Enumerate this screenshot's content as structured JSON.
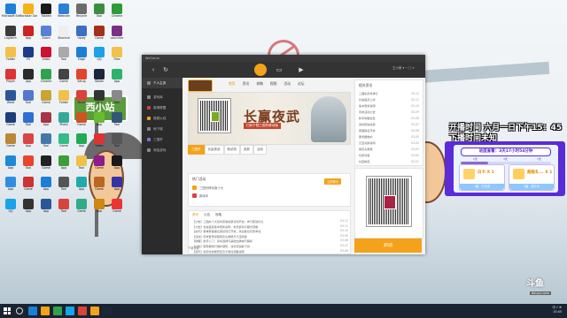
{
  "desktop": {
    "icons": [
      {
        "label": "Microsoft Edge",
        "color": "#1d7fd8"
      },
      {
        "label": "Rockstar Games",
        "color": "#f6b21b"
      },
      {
        "label": "Tabbed",
        "color": "#1a1a1a"
      },
      {
        "label": "Webcam",
        "color": "#2b7fd8"
      },
      {
        "label": "Recycle",
        "color": "#6c6c6c"
      },
      {
        "label": "Tool",
        "color": "#3a8f3e"
      },
      {
        "label": "Chrome",
        "color": "#2d9b3a"
      },
      {
        "label": "Logitech",
        "color": "#3b3b3b"
      },
      {
        "label": "App",
        "color": "#c22"
      },
      {
        "label": "Zoom",
        "color": "#5a7fd6"
      },
      {
        "label": "Shortcut",
        "color": "#eee"
      },
      {
        "label": "Uplay",
        "color": "#3a6ec4"
      },
      {
        "label": "Game",
        "color": "#a3301c"
      },
      {
        "label": "Launcher",
        "color": "#7a2f87"
      },
      {
        "label": "Folder",
        "color": "#f0c24a"
      },
      {
        "label": "PS",
        "color": "#1f3a8a"
      },
      {
        "label": "Video",
        "color": "#c13"
      },
      {
        "label": "Tool",
        "color": "#aaa"
      },
      {
        "label": "Edge",
        "color": "#1b7fd6"
      },
      {
        "label": "QQ",
        "color": "#1aa3e8"
      },
      {
        "label": "Files",
        "color": "#f0c24a"
      },
      {
        "label": "Player",
        "color": "#d33"
      },
      {
        "label": "App",
        "color": "#2a2a2a"
      },
      {
        "label": "Chrome",
        "color": "#31a24c"
      },
      {
        "label": "Game",
        "color": "#444"
      },
      {
        "label": "Setup",
        "color": "#e2452a"
      },
      {
        "label": "Steam",
        "color": "#1b2838"
      },
      {
        "label": "App",
        "color": "#2cb36b"
      },
      {
        "label": "Word",
        "color": "#2b5797"
      },
      {
        "label": "Tool",
        "color": "#5577cc"
      },
      {
        "label": "Game",
        "color": "#c8a434"
      },
      {
        "label": "Folder",
        "color": "#f0c24a"
      },
      {
        "label": "Music",
        "color": "#d9433b"
      },
      {
        "label": "App",
        "color": "#333"
      },
      {
        "label": "Tool",
        "color": "#888"
      },
      {
        "label": "Game",
        "color": "#1b3f7a"
      },
      {
        "label": "Tool",
        "color": "#2f6fd1"
      },
      {
        "label": "App",
        "color": "#a34"
      },
      {
        "label": "Photo",
        "color": "#3a9"
      },
      {
        "label": "Game",
        "color": "#c52"
      },
      {
        "label": "App",
        "color": "#6b3"
      },
      {
        "label": "Tool",
        "color": "#357"
      },
      {
        "label": "Game",
        "color": "#b83"
      },
      {
        "label": "App",
        "color": "#d44"
      },
      {
        "label": "Tool",
        "color": "#47a"
      },
      {
        "label": "Game",
        "color": "#3b8"
      },
      {
        "label": "App",
        "color": "#2a5"
      },
      {
        "label": "Video",
        "color": "#d33"
      },
      {
        "label": "Tool",
        "color": "#555"
      },
      {
        "label": "App",
        "color": "#1c8ad6"
      },
      {
        "label": "Tool",
        "color": "#e8442f"
      },
      {
        "label": "Game",
        "color": "#222"
      },
      {
        "label": "App",
        "color": "#3c9d3a"
      },
      {
        "label": "Tool",
        "color": "#f0c24a"
      },
      {
        "label": "Game",
        "color": "#8d1d8a"
      },
      {
        "label": "App",
        "color": "#1a1a1a"
      },
      {
        "label": "App",
        "color": "#2f8ee0"
      },
      {
        "label": "Game",
        "color": "#c33"
      },
      {
        "label": "App",
        "color": "#1b7fd6"
      },
      {
        "label": "Tool",
        "color": "#555"
      },
      {
        "label": "App",
        "color": "#2aa"
      },
      {
        "label": "Game",
        "color": "#b62"
      },
      {
        "label": "App",
        "color": "#33a"
      },
      {
        "label": "QQ",
        "color": "#1aa3e8"
      },
      {
        "label": "App",
        "color": "#333"
      },
      {
        "label": "App",
        "color": "#2b5797"
      },
      {
        "label": "Tool",
        "color": "#d9433b"
      },
      {
        "label": "Game",
        "color": "#3a8"
      },
      {
        "label": "App",
        "color": "#c81"
      },
      {
        "label": "Game",
        "color": "#e33"
      }
    ],
    "sign_text": "西小站"
  },
  "app": {
    "window_title": "WeGame",
    "toolbar": {
      "back": "‹",
      "refresh": "↻",
      "right_text": "王小美 ▾   ─  □  ✕"
    },
    "sidebar": [
      {
        "label": "个人主页",
        "style": "active"
      },
      {
        "label": "游戏库",
        "style": ""
      },
      {
        "label": "英雄联盟",
        "style": "red"
      },
      {
        "label": "穿越火线",
        "style": "orange"
      },
      {
        "label": "地下城",
        "style": ""
      },
      {
        "label": "三国杀",
        "style": "purple"
      },
      {
        "label": "添加游戏",
        "style": ""
      }
    ],
    "game_tabs": [
      {
        "label": "首页",
        "active": true
      },
      {
        "label": "资讯",
        "active": false
      },
      {
        "label": "攻略",
        "active": false
      },
      {
        "label": "视频",
        "active": false
      },
      {
        "label": "活动",
        "active": false
      },
      {
        "label": "论坛",
        "active": false
      }
    ],
    "banner": {
      "title": "长赢夜武",
      "sub": "扫码下载三国杀移动版"
    },
    "banner_tabs": [
      {
        "label": "三国杀",
        "active": true
      },
      {
        "label": "长赢夜武",
        "active": false
      },
      {
        "label": "新武将",
        "active": false
      },
      {
        "label": "皮肤",
        "active": false
      },
      {
        "label": "活动",
        "active": false
      }
    ],
    "hot": {
      "title": "热门活动",
      "button": "立即参与",
      "rows": [
        "三国杀移动版十大",
        "新版本"
      ]
    },
    "news_tabs": [
      {
        "label": "资讯",
        "active": true
      },
      {
        "label": "公告",
        "active": false
      },
      {
        "label": "攻略",
        "active": false
      }
    ],
    "news": [
      {
        "title": "【公告】三国杀十大武将皮肤投票活动开启，参与即送好礼",
        "date": "03-12"
      },
      {
        "title": "【公告】长赢夜武版本更新说明，新增武将与模式调整",
        "date": "03-11"
      },
      {
        "title": "【资讯】春季赛事报名通道现已开放，欢迎各位玩家参加",
        "date": "03-10"
      },
      {
        "title": "【活动】周末登录领取限定头像框与元宝奖励",
        "date": "03-09"
      },
      {
        "title": "【攻略】新手入门：武将选择与基础出牌技巧解析",
        "date": "03-08"
      },
      {
        "title": "【公告】服务器例行维护通知，请玩家提前下线",
        "date": "03-07"
      },
      {
        "title": "【资讯】新武将技能预览及平衡性调整说明",
        "date": "03-06"
      }
    ],
    "right_news_head": "相关资讯",
    "right_news": [
      {
        "title": "三国杀武将排行",
        "date": "03-12"
      },
      {
        "title": "长赢夜武上线",
        "date": "03-11"
      },
      {
        "title": "版本更新说明",
        "date": "03-10"
      },
      {
        "title": "周末活动公告",
        "date": "03-09"
      },
      {
        "title": "新手攻略合集",
        "date": "03-08"
      },
      {
        "title": "武将皮肤投票",
        "date": "03-07"
      },
      {
        "title": "赛事报名开启",
        "date": "03-06"
      },
      {
        "title": "服务器维护",
        "date": "03-05"
      },
      {
        "title": "元宝兑换说明",
        "date": "03-04"
      },
      {
        "title": "限定头像框",
        "date": "03-03"
      },
      {
        "title": "玩家问答",
        "date": "03-02"
      },
      {
        "title": "社区精选",
        "date": "03-01"
      }
    ],
    "launch_label": "启动",
    "footer_link": "下载设置"
  },
  "overlay": {
    "line1": "开播时间 六月一日下午15：45",
    "line2": "下播时间未知",
    "panel_head": "进度查看：3天17小时54分钟",
    "progress": 0.3,
    "milestones": [
      "1天",
      "3天",
      "7天"
    ],
    "rewards": [
      {
        "name": "白卡 X 1",
        "status": "1级 · 已完成",
        "color": "#ffd36b"
      },
      {
        "name": "超级礼... X 1",
        "status": "1级 · 进行中",
        "color": "#ffcf5a"
      }
    ],
    "brand": "斗鱼",
    "brand_sub": "douyu.com"
  },
  "taskbar": {
    "items": [
      "#1b7fd6",
      "#f3a21a",
      "#31a24c",
      "#1aa3e8",
      "#d9433b",
      "#f3a21a",
      "#1b2838"
    ],
    "tray_line1": "中  ♪  ⊕",
    "tray_line2": "15:45"
  }
}
